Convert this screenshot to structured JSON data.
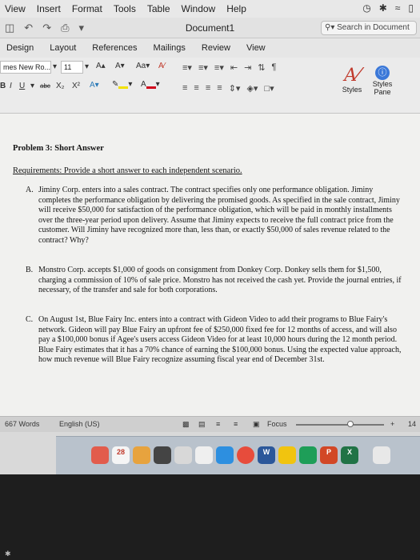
{
  "menubar": {
    "items": [
      "View",
      "Insert",
      "Format",
      "Tools",
      "Table",
      "Window",
      "Help"
    ]
  },
  "titlebar": {
    "document_title": "Document1",
    "search_placeholder": "Search in Document"
  },
  "ribbon_tabs": [
    "Design",
    "Layout",
    "References",
    "Mailings",
    "Review",
    "View"
  ],
  "ribbon": {
    "font_name": "mes New Ro...",
    "font_size": "11",
    "grow_font": "A▴",
    "shrink_font": "A▾",
    "bold": "B",
    "italic": "I",
    "underline": "U",
    "strikethrough": "abc",
    "subscript": "X₂",
    "superscript": "X²",
    "styles_label": "Styles",
    "styles_pane_label": "Styles Pane",
    "colors": {
      "highlight": "#f2e100",
      "font_color": "#d0021b",
      "styles_icon": "#c0392b",
      "pane_icon": "#3b78d8"
    }
  },
  "document": {
    "heading": "Problem 3: Short Answer",
    "requirements": "Requirements: Provide a short answer to each independent scenario.",
    "items": [
      {
        "label": "A.",
        "text": "Jiminy Corp. enters into a sales contract. The contract specifies only one performance obligation. Jiminy completes the performance obligation by delivering the promised goods. As specified in the sale contract, Jiminy will receive $50,000 for satisfaction of the performance obligation, which will be paid in monthly installments over the three-year period upon delivery. Assume that Jiminy expects to receive the full contract price from the customer. Will Jiminy have recognized more than, less than, or exactly $50,000 of sales revenue related to the contract? Why?"
      },
      {
        "label": "B.",
        "text": "Monstro Corp. accepts $1,000 of goods on consignment from Donkey Corp. Donkey sells them for $1,500, charging a commission of 10% of sale price. Monstro has not received the cash yet. Provide the journal entries, if necessary, of the transfer and sale for both corporations."
      },
      {
        "label": "C.",
        "text": "On August 1st, Blue Fairy Inc. enters into a contract with Gideon Video to add their programs to Blue Fairy's network. Gideon will pay Blue Fairy an upfront fee of $250,000 fixed fee for 12 months of access, and will also pay a $100,000 bonus if Agee's users access Gideon Video for at least 10,000 hours during the 12 month period. Blue Fairy estimates that it has a 70% chance of earning the $100,000 bonus. Using the expected value approach, how much revenue will Blue Fairy recognize assuming fiscal year end of December 31st."
      }
    ]
  },
  "statusbar": {
    "word_count": "667 Words",
    "language": "English (US)",
    "focus": "Focus",
    "zoom_plus": "+",
    "zoom_value": "14"
  },
  "dock": {
    "calendar_day": "28",
    "word_letter": "W",
    "powerpoint_letter": "P",
    "excel_letter": "X"
  }
}
